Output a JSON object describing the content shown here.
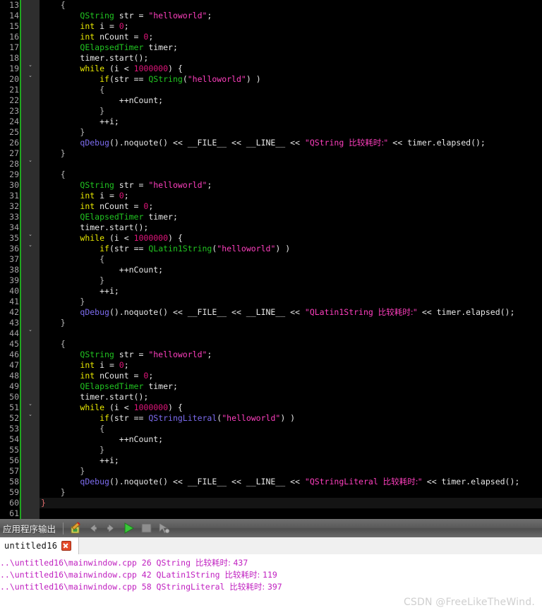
{
  "editor": {
    "first_line": 13,
    "current_line": 60,
    "lines": [
      {
        "n": 13,
        "fold": false,
        "indent": 4,
        "tokens": [
          {
            "t": "{",
            "c": "t-brace"
          }
        ]
      },
      {
        "n": 14,
        "fold": false,
        "indent": 8,
        "tokens": [
          {
            "t": "QString",
            "c": "t-type"
          },
          {
            "t": " str = ",
            "c": "t-pln"
          },
          {
            "t": "\"helloworld\"",
            "c": "t-str"
          },
          {
            "t": ";",
            "c": "t-pln"
          }
        ]
      },
      {
        "n": 15,
        "fold": false,
        "indent": 8,
        "tokens": [
          {
            "t": "int",
            "c": "t-kw"
          },
          {
            "t": " i = ",
            "c": "t-pln"
          },
          {
            "t": "0",
            "c": "t-num"
          },
          {
            "t": ";",
            "c": "t-pln"
          }
        ]
      },
      {
        "n": 16,
        "fold": false,
        "indent": 8,
        "tokens": [
          {
            "t": "int",
            "c": "t-kw"
          },
          {
            "t": " nCount = ",
            "c": "t-pln"
          },
          {
            "t": "0",
            "c": "t-num"
          },
          {
            "t": ";",
            "c": "t-pln"
          }
        ]
      },
      {
        "n": 17,
        "fold": false,
        "indent": 8,
        "tokens": [
          {
            "t": "QElapsedTimer",
            "c": "t-type"
          },
          {
            "t": " timer;",
            "c": "t-pln"
          }
        ]
      },
      {
        "n": 18,
        "fold": false,
        "indent": 8,
        "tokens": [
          {
            "t": "timer.start();",
            "c": "t-pln"
          }
        ]
      },
      {
        "n": 19,
        "fold": true,
        "indent": 8,
        "tokens": [
          {
            "t": "while",
            "c": "t-kw"
          },
          {
            "t": " (i < ",
            "c": "t-pln"
          },
          {
            "t": "1000000",
            "c": "t-num"
          },
          {
            "t": ") {",
            "c": "t-pln"
          }
        ]
      },
      {
        "n": 20,
        "fold": true,
        "indent": 12,
        "tokens": [
          {
            "t": "if",
            "c": "t-kw"
          },
          {
            "t": "(str == ",
            "c": "t-pln"
          },
          {
            "t": "QString",
            "c": "t-type"
          },
          {
            "t": "(",
            "c": "t-pln"
          },
          {
            "t": "\"helloworld\"",
            "c": "t-str"
          },
          {
            "t": ") )",
            "c": "t-pln"
          }
        ]
      },
      {
        "n": 21,
        "fold": false,
        "indent": 12,
        "tokens": [
          {
            "t": "{",
            "c": "t-brace"
          }
        ]
      },
      {
        "n": 22,
        "fold": false,
        "indent": 16,
        "tokens": [
          {
            "t": "++nCount;",
            "c": "t-pln"
          }
        ]
      },
      {
        "n": 23,
        "fold": false,
        "indent": 12,
        "tokens": [
          {
            "t": "}",
            "c": "t-brace"
          }
        ]
      },
      {
        "n": 24,
        "fold": false,
        "indent": 12,
        "tokens": [
          {
            "t": "++i;",
            "c": "t-pln"
          }
        ]
      },
      {
        "n": 25,
        "fold": false,
        "indent": 8,
        "tokens": [
          {
            "t": "}",
            "c": "t-brace"
          }
        ]
      },
      {
        "n": 26,
        "fold": false,
        "indent": 8,
        "tokens": [
          {
            "t": "qDebug",
            "c": "t-macro"
          },
          {
            "t": "().noquote() << __FILE__ << __LINE__ << ",
            "c": "t-pln"
          },
          {
            "t": "\"QString ",
            "c": "t-str"
          },
          {
            "t": "比较耗时:\"",
            "c": "t-str t-cjk"
          },
          {
            "t": " << timer.elapsed();",
            "c": "t-pln"
          }
        ]
      },
      {
        "n": 27,
        "fold": false,
        "indent": 4,
        "tokens": [
          {
            "t": "}",
            "c": "t-brace"
          }
        ]
      },
      {
        "n": 28,
        "fold": true,
        "indent": 0,
        "tokens": []
      },
      {
        "n": 29,
        "fold": false,
        "indent": 4,
        "tokens": [
          {
            "t": "{",
            "c": "t-brace"
          }
        ]
      },
      {
        "n": 30,
        "fold": false,
        "indent": 8,
        "tokens": [
          {
            "t": "QString",
            "c": "t-type"
          },
          {
            "t": " str = ",
            "c": "t-pln"
          },
          {
            "t": "\"helloworld\"",
            "c": "t-str"
          },
          {
            "t": ";",
            "c": "t-pln"
          }
        ]
      },
      {
        "n": 31,
        "fold": false,
        "indent": 8,
        "tokens": [
          {
            "t": "int",
            "c": "t-kw"
          },
          {
            "t": " i = ",
            "c": "t-pln"
          },
          {
            "t": "0",
            "c": "t-num"
          },
          {
            "t": ";",
            "c": "t-pln"
          }
        ]
      },
      {
        "n": 32,
        "fold": false,
        "indent": 8,
        "tokens": [
          {
            "t": "int",
            "c": "t-kw"
          },
          {
            "t": " nCount = ",
            "c": "t-pln"
          },
          {
            "t": "0",
            "c": "t-num"
          },
          {
            "t": ";",
            "c": "t-pln"
          }
        ]
      },
      {
        "n": 33,
        "fold": false,
        "indent": 8,
        "tokens": [
          {
            "t": "QElapsedTimer",
            "c": "t-type"
          },
          {
            "t": " timer;",
            "c": "t-pln"
          }
        ]
      },
      {
        "n": 34,
        "fold": false,
        "indent": 8,
        "tokens": [
          {
            "t": "timer.start();",
            "c": "t-pln"
          }
        ]
      },
      {
        "n": 35,
        "fold": true,
        "indent": 8,
        "tokens": [
          {
            "t": "while",
            "c": "t-kw"
          },
          {
            "t": " (i < ",
            "c": "t-pln"
          },
          {
            "t": "1000000",
            "c": "t-num"
          },
          {
            "t": ") {",
            "c": "t-pln"
          }
        ]
      },
      {
        "n": 36,
        "fold": true,
        "indent": 12,
        "tokens": [
          {
            "t": "if",
            "c": "t-kw"
          },
          {
            "t": "(str == ",
            "c": "t-pln"
          },
          {
            "t": "QLatin1String",
            "c": "t-type"
          },
          {
            "t": "(",
            "c": "t-pln"
          },
          {
            "t": "\"helloworld\"",
            "c": "t-str"
          },
          {
            "t": ") )",
            "c": "t-pln"
          }
        ]
      },
      {
        "n": 37,
        "fold": false,
        "indent": 12,
        "tokens": [
          {
            "t": "{",
            "c": "t-brace"
          }
        ]
      },
      {
        "n": 38,
        "fold": false,
        "indent": 16,
        "tokens": [
          {
            "t": "++nCount;",
            "c": "t-pln"
          }
        ]
      },
      {
        "n": 39,
        "fold": false,
        "indent": 12,
        "tokens": [
          {
            "t": "}",
            "c": "t-brace"
          }
        ]
      },
      {
        "n": 40,
        "fold": false,
        "indent": 12,
        "tokens": [
          {
            "t": "++i;",
            "c": "t-pln"
          }
        ]
      },
      {
        "n": 41,
        "fold": false,
        "indent": 8,
        "tokens": [
          {
            "t": "}",
            "c": "t-brace"
          }
        ]
      },
      {
        "n": 42,
        "fold": false,
        "indent": 8,
        "tokens": [
          {
            "t": "qDebug",
            "c": "t-macro"
          },
          {
            "t": "().noquote() << __FILE__ << __LINE__ << ",
            "c": "t-pln"
          },
          {
            "t": "\"QLatin1String ",
            "c": "t-str"
          },
          {
            "t": "比较耗时:\"",
            "c": "t-str t-cjk"
          },
          {
            "t": " << timer.elapsed();",
            "c": "t-pln"
          }
        ]
      },
      {
        "n": 43,
        "fold": false,
        "indent": 4,
        "tokens": [
          {
            "t": "}",
            "c": "t-brace"
          }
        ]
      },
      {
        "n": 44,
        "fold": true,
        "indent": 0,
        "tokens": []
      },
      {
        "n": 45,
        "fold": false,
        "indent": 4,
        "tokens": [
          {
            "t": "{",
            "c": "t-brace"
          }
        ]
      },
      {
        "n": 46,
        "fold": false,
        "indent": 8,
        "tokens": [
          {
            "t": "QString",
            "c": "t-type"
          },
          {
            "t": " str = ",
            "c": "t-pln"
          },
          {
            "t": "\"helloworld\"",
            "c": "t-str"
          },
          {
            "t": ";",
            "c": "t-pln"
          }
        ]
      },
      {
        "n": 47,
        "fold": false,
        "indent": 8,
        "tokens": [
          {
            "t": "int",
            "c": "t-kw"
          },
          {
            "t": " i = ",
            "c": "t-pln"
          },
          {
            "t": "0",
            "c": "t-num"
          },
          {
            "t": ";",
            "c": "t-pln"
          }
        ]
      },
      {
        "n": 48,
        "fold": false,
        "indent": 8,
        "tokens": [
          {
            "t": "int",
            "c": "t-kw"
          },
          {
            "t": " nCount = ",
            "c": "t-pln"
          },
          {
            "t": "0",
            "c": "t-num"
          },
          {
            "t": ";",
            "c": "t-pln"
          }
        ]
      },
      {
        "n": 49,
        "fold": false,
        "indent": 8,
        "tokens": [
          {
            "t": "QElapsedTimer",
            "c": "t-type"
          },
          {
            "t": " timer;",
            "c": "t-pln"
          }
        ]
      },
      {
        "n": 50,
        "fold": false,
        "indent": 8,
        "tokens": [
          {
            "t": "timer.start();",
            "c": "t-pln"
          }
        ]
      },
      {
        "n": 51,
        "fold": true,
        "indent": 8,
        "tokens": [
          {
            "t": "while",
            "c": "t-kw"
          },
          {
            "t": " (i < ",
            "c": "t-pln"
          },
          {
            "t": "1000000",
            "c": "t-num"
          },
          {
            "t": ") {",
            "c": "t-pln"
          }
        ]
      },
      {
        "n": 52,
        "fold": true,
        "indent": 12,
        "tokens": [
          {
            "t": "if",
            "c": "t-kw"
          },
          {
            "t": "(str == ",
            "c": "t-pln"
          },
          {
            "t": "QStringLiteral",
            "c": "t-macro"
          },
          {
            "t": "(",
            "c": "t-pln"
          },
          {
            "t": "\"helloworld\"",
            "c": "t-str"
          },
          {
            "t": ") )",
            "c": "t-pln"
          }
        ]
      },
      {
        "n": 53,
        "fold": false,
        "indent": 12,
        "tokens": [
          {
            "t": "{",
            "c": "t-brace"
          }
        ]
      },
      {
        "n": 54,
        "fold": false,
        "indent": 16,
        "tokens": [
          {
            "t": "++nCount;",
            "c": "t-pln"
          }
        ]
      },
      {
        "n": 55,
        "fold": false,
        "indent": 12,
        "tokens": [
          {
            "t": "}",
            "c": "t-brace"
          }
        ]
      },
      {
        "n": 56,
        "fold": false,
        "indent": 12,
        "tokens": [
          {
            "t": "++i;",
            "c": "t-pln"
          }
        ]
      },
      {
        "n": 57,
        "fold": false,
        "indent": 8,
        "tokens": [
          {
            "t": "}",
            "c": "t-brace"
          }
        ]
      },
      {
        "n": 58,
        "fold": false,
        "indent": 8,
        "tokens": [
          {
            "t": "qDebug",
            "c": "t-macro"
          },
          {
            "t": "().noquote() << __FILE__ << __LINE__ << ",
            "c": "t-pln"
          },
          {
            "t": "\"QStringLiteral ",
            "c": "t-str"
          },
          {
            "t": "比较耗时:\"",
            "c": "t-str t-cjk"
          },
          {
            "t": " << timer.elapsed();",
            "c": "t-pln"
          }
        ]
      },
      {
        "n": 59,
        "fold": false,
        "indent": 4,
        "tokens": [
          {
            "t": "}",
            "c": "t-brace"
          }
        ]
      },
      {
        "n": 60,
        "fold": false,
        "indent": 0,
        "tokens": [
          {
            "t": "}",
            "c": "t-cur"
          }
        ]
      },
      {
        "n": 61,
        "fold": false,
        "indent": 0,
        "tokens": []
      }
    ]
  },
  "output_panel": {
    "title": "应用程序输出",
    "toolbar": [
      {
        "name": "clear-pane-icon",
        "label": "清空"
      },
      {
        "name": "previous-item-icon",
        "label": "上一项"
      },
      {
        "name": "next-item-icon",
        "label": "下一项"
      },
      {
        "name": "run-icon",
        "label": "运行"
      },
      {
        "name": "stop-icon",
        "label": "停止"
      },
      {
        "name": "attach-debugger-icon",
        "label": "附加调试器"
      }
    ],
    "tabs": [
      {
        "name": "untitled16",
        "closable": true
      }
    ],
    "lines": [
      {
        "path": "..\\untitled16\\mainwindow.cpp",
        "lineno": "26",
        "label": "QString",
        "cjk": "比较耗时:",
        "value": "437"
      },
      {
        "path": "..\\untitled16\\mainwindow.cpp",
        "lineno": "42",
        "label": "QLatin1String",
        "cjk": "比较耗时:",
        "value": "119"
      },
      {
        "path": "..\\untitled16\\mainwindow.cpp",
        "lineno": "58",
        "label": "QStringLiteral",
        "cjk": "比较耗时:",
        "value": "397"
      }
    ]
  },
  "watermark": {
    "text": "CSDN @FreeLikeTheWind."
  },
  "colors": {
    "editor_bg": "#000000",
    "gutter_fold_bg": "#2e2e2e",
    "modified_marker": "#1ea61e",
    "line_number": "#a6a6a6",
    "keyword": "#e8e800",
    "type": "#21c421",
    "string": "#ff3fbf",
    "number": "#e0157a",
    "macro": "#7c6cf0",
    "plain": "#e8e8e8",
    "current_line_bg": "#141414",
    "output_text": "#c020c0",
    "panel_bar": "#5a5a5a"
  }
}
